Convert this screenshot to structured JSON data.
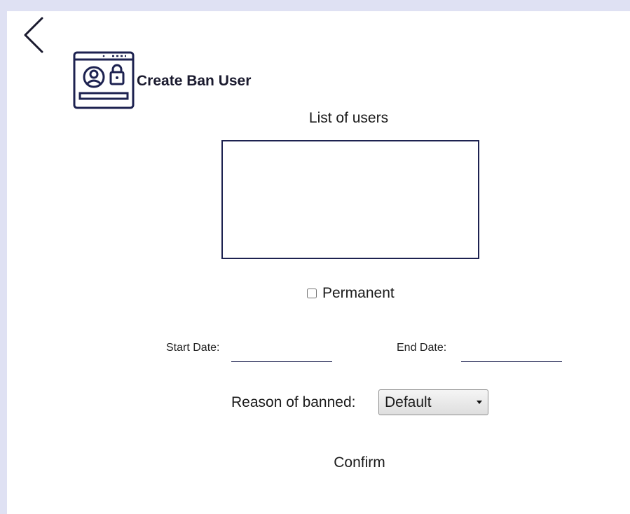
{
  "header": {
    "title": "Create Ban User",
    "back_icon": "chevron-left-icon",
    "header_icon": "user-lock-window-icon"
  },
  "users": {
    "label": "List of users",
    "items": []
  },
  "permanent": {
    "label": "Permanent",
    "checked": false
  },
  "dates": {
    "start_label": "Start Date:",
    "start_value": "",
    "end_label": "End Date:",
    "end_value": ""
  },
  "reason": {
    "label": "Reason of banned:",
    "selected": "Default"
  },
  "actions": {
    "confirm_label": "Confirm"
  },
  "colors": {
    "accent": "#1d2250",
    "border_band": "#dfe1f3"
  }
}
